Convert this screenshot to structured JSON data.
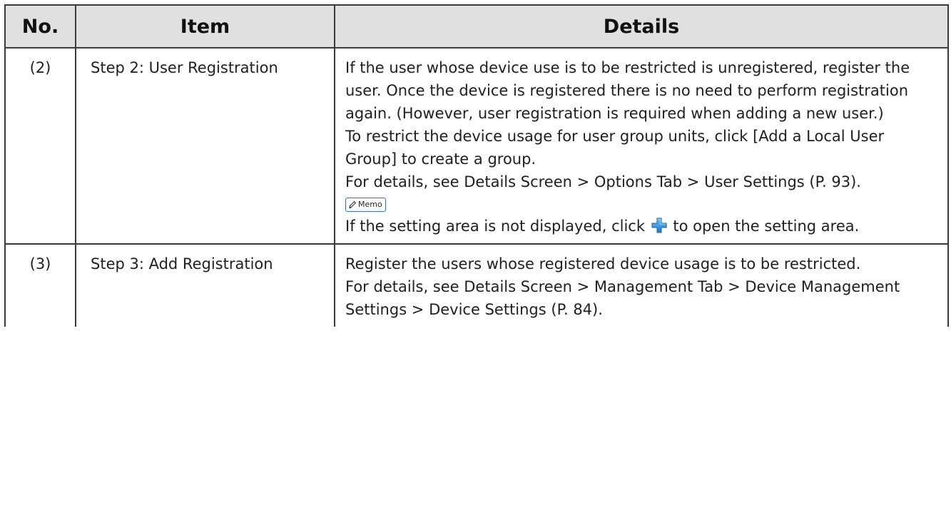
{
  "table": {
    "headers": {
      "no": "No.",
      "item": "Item",
      "details": "Details"
    },
    "rows": [
      {
        "no": "(2)",
        "item": "Step 2: User Registration",
        "details": {
          "p1": "If the user whose device use is to be restricted is unregistered, register the user. Once the device is registered there is no need to perform registration again. (However, user registration is required when adding a new user.)",
          "p2": "To restrict the device usage for user group units, click [Add a Local User Group] to create a group.",
          "p3": "For details, see Details Screen > Options Tab > User Settings (P. 93).",
          "memo_label": "Memo",
          "memo_before": "If the setting area is not displayed, click ",
          "memo_icon": "plus-icon",
          "memo_after": " to open the setting area."
        }
      },
      {
        "no": "(3)",
        "item": "Step 3: Add Registration",
        "details": {
          "p1": "Register the users whose registered device usage is to be restricted.",
          "p2": "For details, see Details Screen > Management Tab > Device Management Settings > Device Settings (P. 84)."
        }
      }
    ]
  },
  "colors": {
    "header_bg": "#e0e0e0",
    "border": "#3a3a3a",
    "memo_border": "#3b6fb6",
    "plus_icon": "#2f8fd6"
  }
}
